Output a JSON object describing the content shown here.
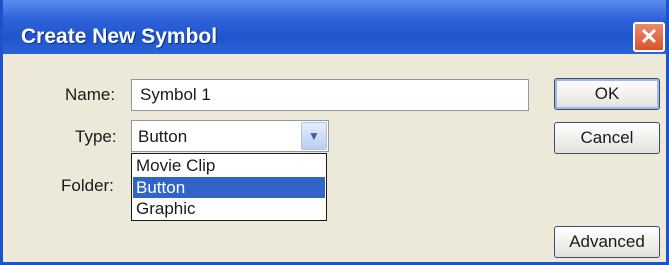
{
  "dialog": {
    "title": "Create New Symbol",
    "close_icon": "close-icon"
  },
  "form": {
    "name_label": "Name:",
    "name_value": "Symbol 1",
    "type_label": "Type:",
    "type_value": "Button",
    "folder_label": "Folder:"
  },
  "type_options": [
    {
      "label": "Movie Clip",
      "selected": false
    },
    {
      "label": "Button",
      "selected": true
    },
    {
      "label": "Graphic",
      "selected": false
    }
  ],
  "buttons": {
    "ok": "OK",
    "cancel": "Cancel",
    "advanced": "Advanced"
  },
  "colors": {
    "titlebar": "#2e62d9",
    "selection": "#3264c8",
    "close": "#d9532c"
  }
}
